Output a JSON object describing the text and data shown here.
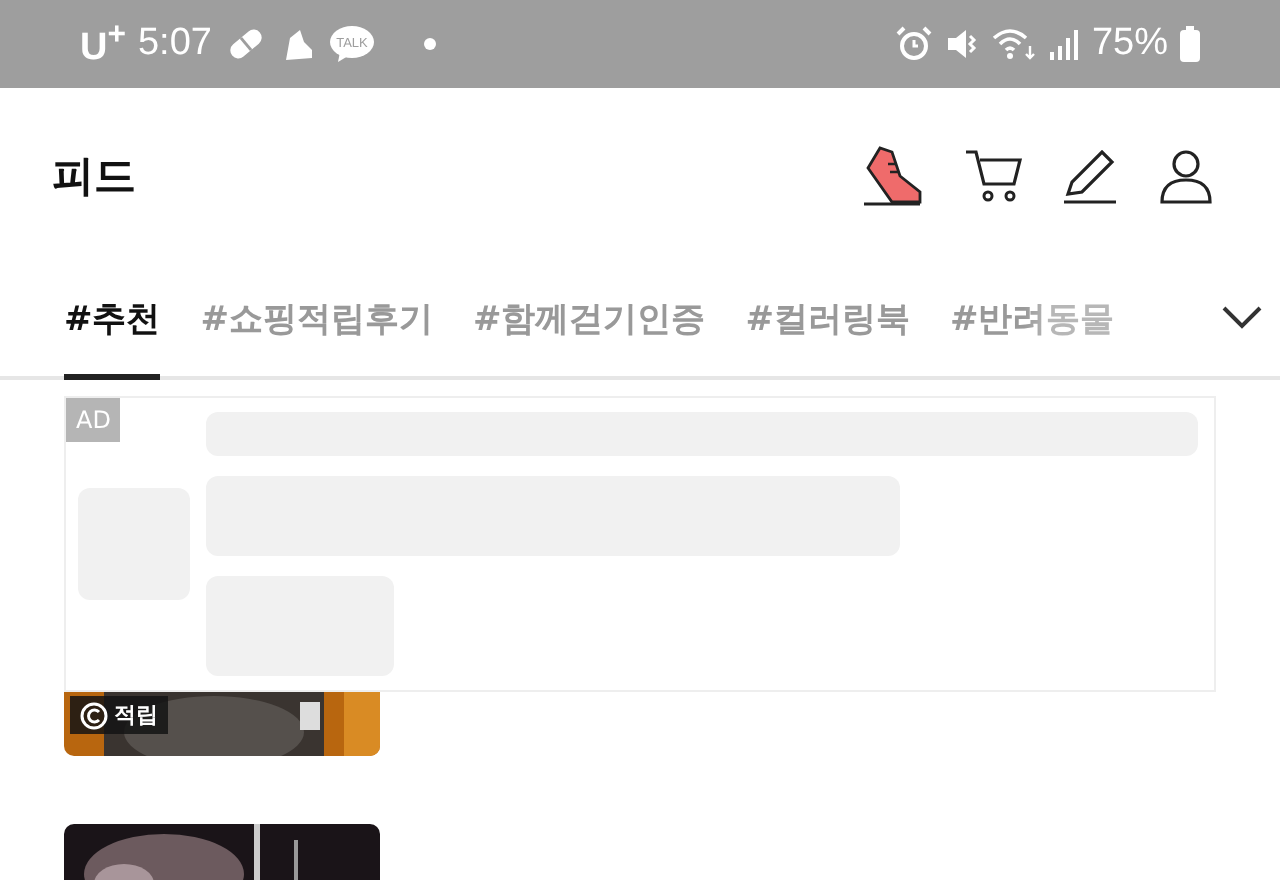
{
  "status_bar": {
    "carrier": "U$^{+}$",
    "time": "5:07",
    "talk_label": "TALK",
    "battery": "75%"
  },
  "header": {
    "title": "피드"
  },
  "tabs": [
    {
      "label": "#추천",
      "selected": true
    },
    {
      "label": "#쇼핑적립후기",
      "selected": false
    },
    {
      "label": "#함께걷기인증",
      "selected": false
    },
    {
      "label": "#컬러링북",
      "selected": false
    },
    {
      "label": "#반려동물",
      "selected": false
    }
  ],
  "ad": {
    "label": "AD"
  },
  "feed": [
    {
      "kind": "picture",
      "badge": "적립"
    },
    {
      "kind": "picture"
    }
  ]
}
